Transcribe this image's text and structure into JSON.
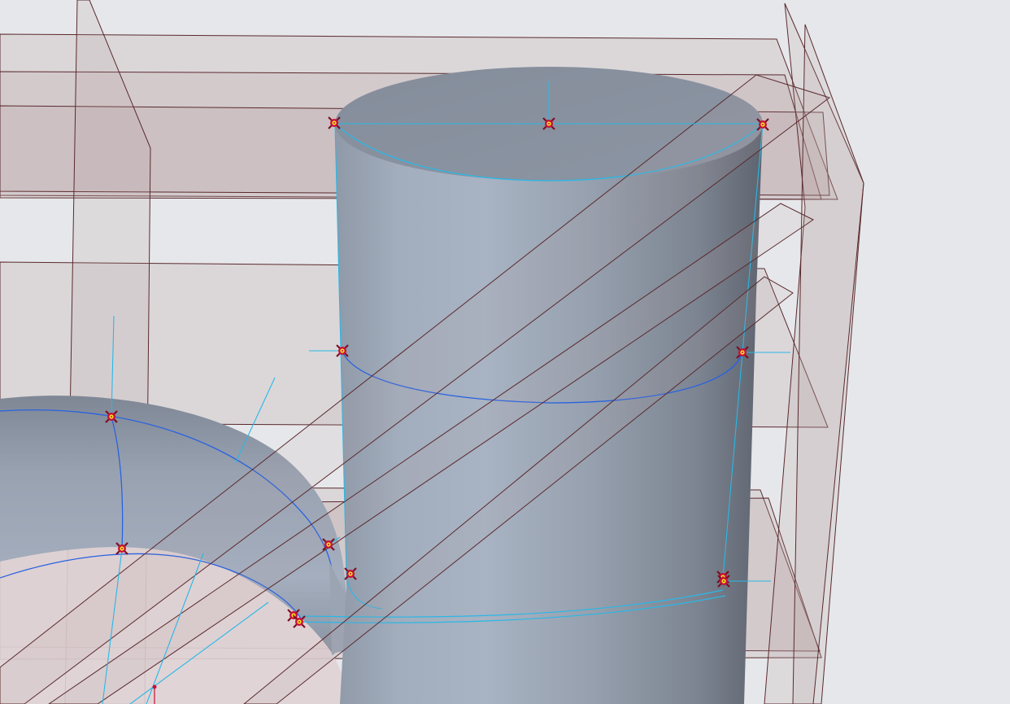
{
  "scene": {
    "name": "cad-3d-viewport",
    "colors": {
      "background": "#e6e7ea",
      "solid_light": "#a5b0bf",
      "solid_mid": "#8d96a4",
      "solid_dark": "#5d6370",
      "datum_plane_fill": "#b79c9c",
      "datum_plane_edge": "#5a2a2e",
      "edge_highlight": "#29b8e6",
      "curve_blue": "#2a62e0",
      "point_marker_ring": "#c8103a",
      "point_marker_core": "#f2e21e"
    },
    "point_marker_icon": "datum-point-marker-icon"
  }
}
